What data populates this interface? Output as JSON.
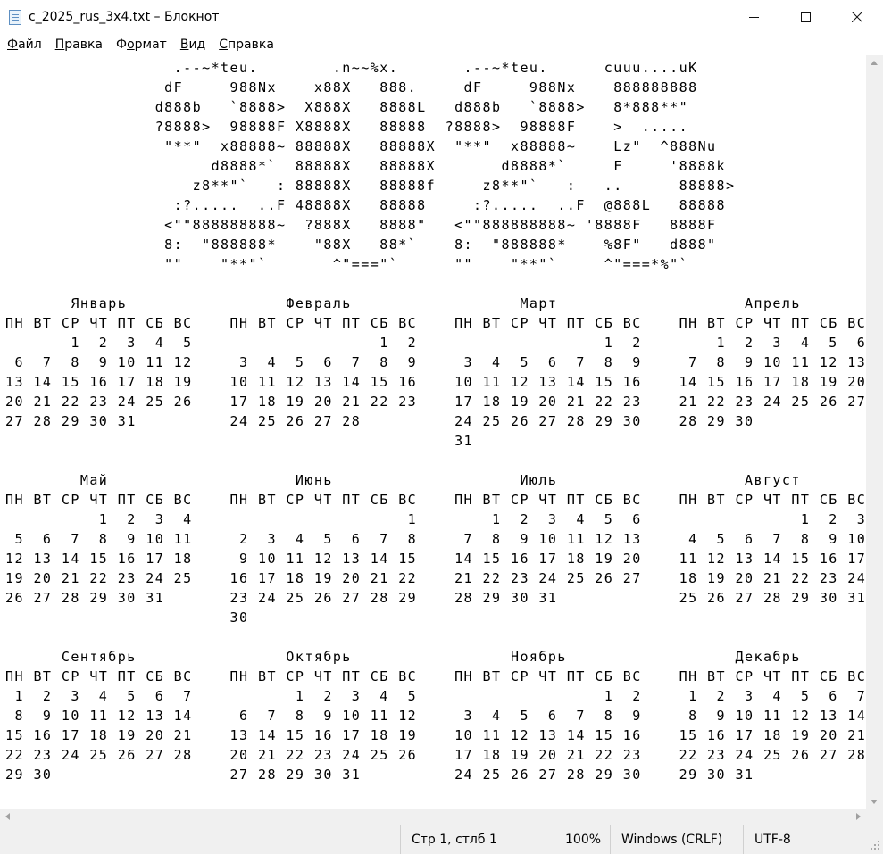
{
  "window": {
    "title": "c_2025_rus_3x4.txt – Блокнот",
    "minimize_label": "—",
    "maximize_label": "☐",
    "close_label": "✕"
  },
  "menu": [
    {
      "key": "Ф",
      "rest": "айл"
    },
    {
      "key": "П",
      "rest": "равка"
    },
    {
      "pre": "Ф",
      "key": "о",
      "rest": "рмат"
    },
    {
      "key": "В",
      "rest": "ид"
    },
    {
      "key": "С",
      "rest": "правка"
    }
  ],
  "editor": {
    "text": "                  .--~*teu.        .n~~%x.       .--~*teu.      cuuu....uK\n                 dF     988Nx    x88X   888.     dF     988Nx    888888888\n                d888b   `8888>  X888X   8888L   d888b   `8888>   8*888**\"\n                ?8888>  98888F X8888X   88888  ?8888>  98888F    >  .....\n                 \"**\"  x88888~ 88888X   88888X  \"**\"  x88888~    Lz\"  ^888Nu\n                      d8888*`  88888X   88888X       d8888*`     F     '8888k\n                    z8**\"`   : 88888X   88888f     z8**\"`   :   ..      88888>\n                  :?.....  ..F 48888X   88888     :?.....  ..F  @888L   88888\n                 <\"\"888888888~  ?888X   8888\"   <\"\"888888888~ '8888F   8888F\n                 8:  \"888888*    \"88X   88*`    8:  \"888888*    %8F\"   d888\"\n                 \"\"    \"**\"`       ^\"===\"`      \"\"    \"**\"`     ^\"===*%\"`\n\n       Январь                 Февраль                  Март                    Апрель\nПН ВТ СР ЧТ ПТ СБ ВС    ПН ВТ СР ЧТ ПТ СБ ВС    ПН ВТ СР ЧТ ПТ СБ ВС    ПН ВТ СР ЧТ ПТ СБ ВС\n       1  2  3  4  5                    1  2                    1  2        1  2  3  4  5  6\n 6  7  8  9 10 11 12     3  4  5  6  7  8  9     3  4  5  6  7  8  9     7  8  9 10 11 12 13\n13 14 15 16 17 18 19    10 11 12 13 14 15 16    10 11 12 13 14 15 16    14 15 16 17 18 19 20\n20 21 22 23 24 25 26    17 18 19 20 21 22 23    17 18 19 20 21 22 23    21 22 23 24 25 26 27\n27 28 29 30 31          24 25 26 27 28          24 25 26 27 28 29 30    28 29 30\n                                                31\n\n        Май                    Июнь                    Июль                    Август\nПН ВТ СР ЧТ ПТ СБ ВС    ПН ВТ СР ЧТ ПТ СБ ВС    ПН ВТ СР ЧТ ПТ СБ ВС    ПН ВТ СР ЧТ ПТ СБ ВС\n          1  2  3  4                       1        1  2  3  4  5  6                 1  2  3\n 5  6  7  8  9 10 11     2  3  4  5  6  7  8     7  8  9 10 11 12 13     4  5  6  7  8  9 10\n12 13 14 15 16 17 18     9 10 11 12 13 14 15    14 15 16 17 18 19 20    11 12 13 14 15 16 17\n19 20 21 22 23 24 25    16 17 18 19 20 21 22    21 22 23 24 25 26 27    18 19 20 21 22 23 24\n26 27 28 29 30 31       23 24 25 26 27 28 29    28 29 30 31             25 26 27 28 29 30 31\n                        30\n\n      Сентябрь                Октябрь                 Ноябрь                  Декабрь\nПН ВТ СР ЧТ ПТ СБ ВС    ПН ВТ СР ЧТ ПТ СБ ВС    ПН ВТ СР ЧТ ПТ СБ ВС    ПН ВТ СР ЧТ ПТ СБ ВС\n 1  2  3  4  5  6  7           1  2  3  4  5                    1  2     1  2  3  4  5  6  7\n 8  9 10 11 12 13 14     6  7  8  9 10 11 12     3  4  5  6  7  8  9     8  9 10 11 12 13 14\n15 16 17 18 19 20 21    13 14 15 16 17 18 19    10 11 12 13 14 15 16    15 16 17 18 19 20 21\n22 23 24 25 26 27 28    20 21 22 23 24 25 26    17 18 19 20 21 22 23    22 23 24 25 26 27 28\n29 30                   27 28 29 30 31          24 25 26 27 28 29 30    29 30 31"
  },
  "status": {
    "position": "Стр 1, стлб 1",
    "zoom": "100%",
    "line_endings": "Windows (CRLF)",
    "encoding": "UTF-8"
  }
}
